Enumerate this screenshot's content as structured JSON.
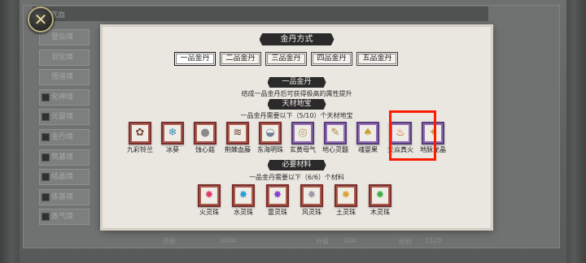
{
  "background": {
    "top_label": "气血",
    "realms": [
      "登仙境",
      "羽化境",
      "悟道境",
      "化神境",
      "元婴境",
      "金丹境",
      "筑基境",
      "结晶境",
      "练基境",
      "炼气境"
    ],
    "realm_checked": [
      false,
      false,
      false,
      true,
      true,
      true,
      true,
      true,
      true,
      true
    ],
    "bottom_values": [
      "灵根",
      "3600",
      "升级",
      "100",
      "经验",
      "3120"
    ]
  },
  "dialog": {
    "title": "金丹方式",
    "tabs": [
      {
        "label": "一品金丹",
        "active": true
      },
      {
        "label": "二品金丹",
        "active": false
      },
      {
        "label": "三品金丹",
        "active": false
      },
      {
        "label": "四品金丹",
        "active": false
      },
      {
        "label": "五品金丹",
        "active": false
      }
    ],
    "grade_heading": "一品金丹",
    "grade_description": "结成一品金丹后可获得极高的属性提升",
    "treasure_heading": "天材地宝",
    "treasure_requirement": "一品金丹需要以下（5/10）个天材地宝",
    "treasures": [
      {
        "label": "九彩铃兰",
        "icon": "orchid-icon",
        "glyph": "✿",
        "color": "#7a4a3a"
      },
      {
        "label": "冰葵",
        "icon": "ice-flower-icon",
        "glyph": "❄",
        "color": "#3a8fb0"
      },
      {
        "label": "蚀心菇",
        "icon": "mushroom-icon",
        "glyph": "●",
        "color": "#8a8a8a"
      },
      {
        "label": "荆棘血藤",
        "icon": "vine-icon",
        "glyph": "≋",
        "color": "#6a3b2a"
      },
      {
        "label": "东海明珠",
        "icon": "pearl-icon",
        "glyph": "◒",
        "color": "#6c7f9a"
      },
      {
        "label": "玄黄母气",
        "icon": "mother-qi-icon",
        "glyph": "◎",
        "color": "#b09a62"
      },
      {
        "label": "地心灵髓",
        "icon": "marrow-icon",
        "glyph": "✎",
        "color": "#a8853f"
      },
      {
        "label": "魂婴果",
        "icon": "gourd-icon",
        "glyph": "♠",
        "color": "#c9a23e"
      },
      {
        "label": "天焱真火",
        "icon": "fire-icon",
        "glyph": "♨",
        "color": "#d2451e"
      },
      {
        "label": "地脉龙晶",
        "icon": "crystal-icon",
        "glyph": "✦",
        "color": "#caa64a"
      }
    ],
    "materials_heading": "必要材料",
    "materials_requirement": "一品金丹需要以下（6/6）个材料",
    "materials": [
      {
        "label": "火灵珠",
        "icon": "fire-orb-icon",
        "glyph": "✸",
        "color": "#e03a6a"
      },
      {
        "label": "水灵珠",
        "icon": "water-orb-icon",
        "glyph": "✸",
        "color": "#2a9fd6"
      },
      {
        "label": "雷灵珠",
        "icon": "thunder-orb-icon",
        "glyph": "✸",
        "color": "#8a3fd1"
      },
      {
        "label": "风灵珠",
        "icon": "wind-orb-icon",
        "glyph": "✸",
        "color": "#9a9aa8"
      },
      {
        "label": "土灵珠",
        "icon": "earth-orb-icon",
        "glyph": "✸",
        "color": "#d8a63a"
      },
      {
        "label": "木灵珠",
        "icon": "wood-orb-icon",
        "glyph": "✸",
        "color": "#3fae4a"
      }
    ],
    "highlight_color": "#ff1a00"
  }
}
